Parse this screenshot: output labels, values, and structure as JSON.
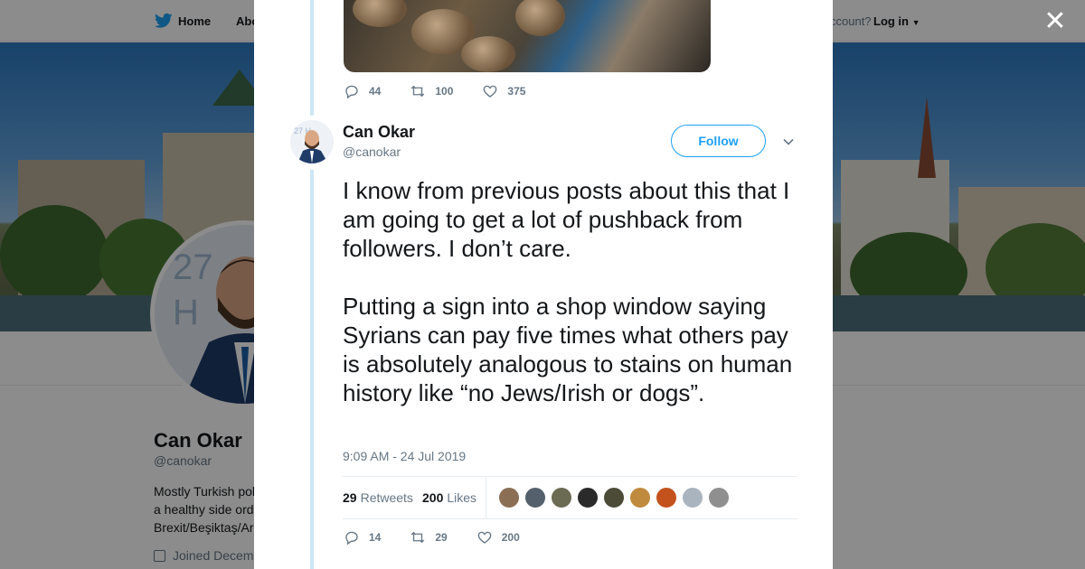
{
  "nav": {
    "home_label": "Home",
    "about_label": "Abo",
    "account_prompt": "ccount?",
    "login_label": "Log in"
  },
  "profile": {
    "name": "Can Okar",
    "handle": "@canokar",
    "bio_lines": [
      "Mostly Turkish pol",
      "a healthy side ord",
      "Brexit/Beşiktaş/Ar"
    ],
    "joined": "Joined Decem"
  },
  "previous_tweet": {
    "replies": "44",
    "retweets": "100",
    "likes": "375"
  },
  "tweet": {
    "author_name": "Can Okar",
    "author_handle": "@canokar",
    "follow_label": "Follow",
    "text": "I know from previous posts about this that I am going to get a lot of pushback from followers. I don’t care.\n\nPutting a sign into a shop window saying Syrians can pay five times what others pay is absolutely analogous to stains on human history like “no Jews/Irish or dogs”.",
    "timestamp": "9:09 AM - 24 Jul 2019",
    "retweet_count": "29",
    "retweet_word": "Retweets",
    "like_count": "200",
    "like_word": "Likes",
    "replies": "14",
    "retweets": "29",
    "likes": "200"
  },
  "colors": {
    "accent": "#1da1f2",
    "thread_line": "#cce6f7",
    "muted_text": "#657786",
    "primary_text": "#14171a"
  },
  "liker_avatars": [
    "#8a6f55",
    "#54606c",
    "#6b6a52",
    "#2a2a2a",
    "#4b4b38",
    "#c08a3e",
    "#c4521d",
    "#aab4be",
    "#8f8f8f"
  ]
}
